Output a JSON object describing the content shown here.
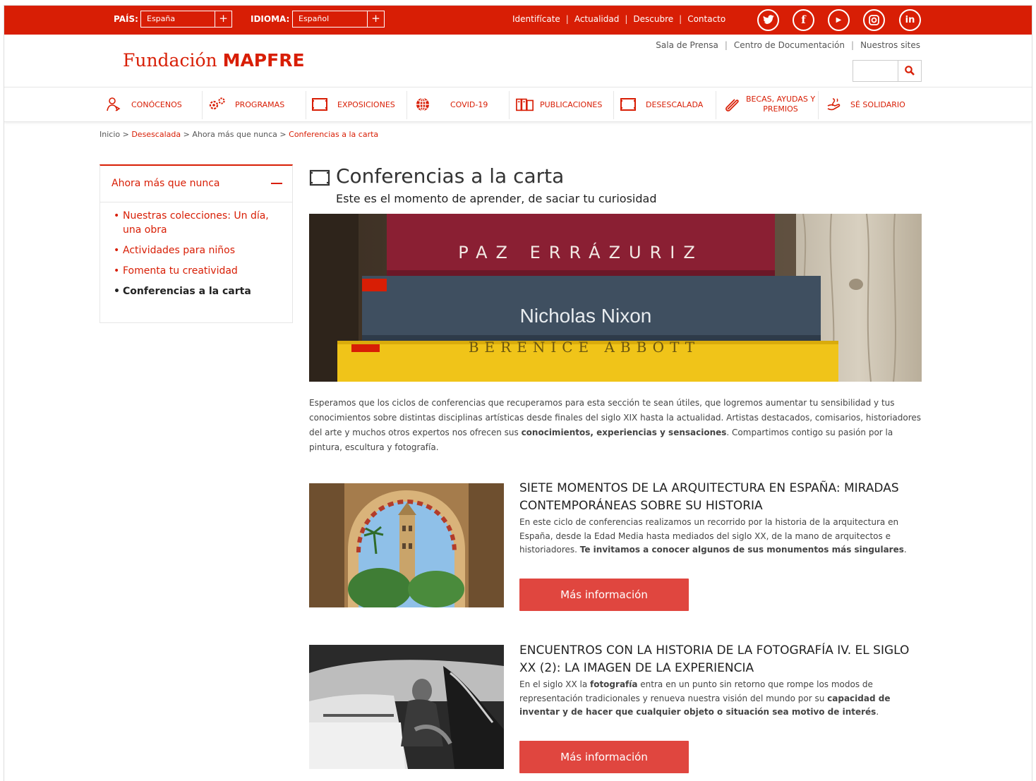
{
  "topbar": {
    "country_label": "PAÍS:",
    "country_value": "España",
    "language_label": "IDIOMA:",
    "language_value": "Español",
    "plus": "+",
    "links": [
      "Identifícate",
      "Actualidad",
      "Descubre",
      "Contacto"
    ],
    "separator": "|",
    "social": [
      "twitter-icon",
      "facebook-icon",
      "youtube-icon",
      "instagram-icon",
      "linkedin-icon"
    ]
  },
  "header": {
    "logo_prefix": "Fundación ",
    "logo_brand": "MAPFRE",
    "links": [
      "Sala de Prensa",
      "Centro de Documentación",
      "Nuestros sites"
    ],
    "search_icon": "search-icon"
  },
  "nav": {
    "items": [
      {
        "label": "CONÓCENOS",
        "icon": "people-icon"
      },
      {
        "label": "PROGRAMAS",
        "icon": "gears-icon"
      },
      {
        "label": "EXPOSICIONES",
        "icon": "frame-icon"
      },
      {
        "label": "COVID-19",
        "icon": "globe-icon"
      },
      {
        "label": "PUBLICACIONES",
        "icon": "books-icon"
      },
      {
        "label": "DESESCALADA",
        "icon": "frame-icon"
      },
      {
        "label": "BECAS, AYUDAS Y PREMIOS",
        "icon": "paperclip-icon"
      },
      {
        "label": "SÉ SOLIDARIO",
        "icon": "hand-icon"
      }
    ]
  },
  "breadcrumb": {
    "home": "Inicio",
    "sep": " > ",
    "level1": "Desescalada",
    "level2": "Ahora más que nunca",
    "current": "Conferencias a la carta"
  },
  "sidebar": {
    "heading": "Ahora más que nunca",
    "items": [
      "Nuestras colecciones: Un día, una obra",
      "Actividades para niños",
      "Fomenta tu creatividad",
      "Conferencias a la carta"
    ]
  },
  "main": {
    "title": "Conferencias a la carta",
    "subtitle": "Este es el momento de aprender, de saciar tu curiosidad",
    "hero_books": [
      "PAZ ERRÁZURIZ",
      "Nicholas Nixon",
      "BERENICE ABBOTT"
    ],
    "intro_1": "Esperamos que los ciclos de conferencias que recuperamos para esta sección te sean útiles, que logremos aumentar tu sensibilidad y tus conocimientos sobre distintas disciplinas artísticas desde finales del siglo XIX hasta la actualidad. Artistas destacados, comisarios, historiadores del arte y muchos otros expertos nos ofrecen sus ",
    "intro_bold": "conocimientos, experiencias y sensaciones",
    "intro_2": ". Compartimos contigo su pasión por la pintura, escultura y fotografía.",
    "cards": [
      {
        "title": "SIETE MOMENTOS DE LA ARQUITECTURA EN ESPAÑA: MIRADAS CONTEMPORÁNEAS SOBRE SU HISTORIA",
        "text_1": "En este ciclo de conferencias realizamos un recorrido por la historia de la arquitectura en España, desde la Edad Media hasta mediados del siglo XX, de la mano de arquitectos e historiadores. ",
        "text_bold": "Te invitamos a conocer algunos de sus monumentos más singulares",
        "text_2": ".",
        "button": "Más información"
      },
      {
        "title": "ENCUENTROS CON LA HISTORIA DE LA FOTOGRAFÍA IV. EL SIGLO XX (2): LA IMAGEN DE LA EXPERIENCIA",
        "text_1": "En el siglo XX la ",
        "text_bold": "fotografía",
        "text_2": " entra en un punto sin retorno que rompe los modos de representación tradicionales y renueva nuestra visión del mundo por su ",
        "text_bold_2": "capacidad de inventar y de hacer que cualquier objeto o situación sea motivo de interés",
        "text_3": ".",
        "button": "Más información"
      }
    ]
  },
  "colors": {
    "brand_red": "#d81e05",
    "button_red": "#e0463f"
  }
}
